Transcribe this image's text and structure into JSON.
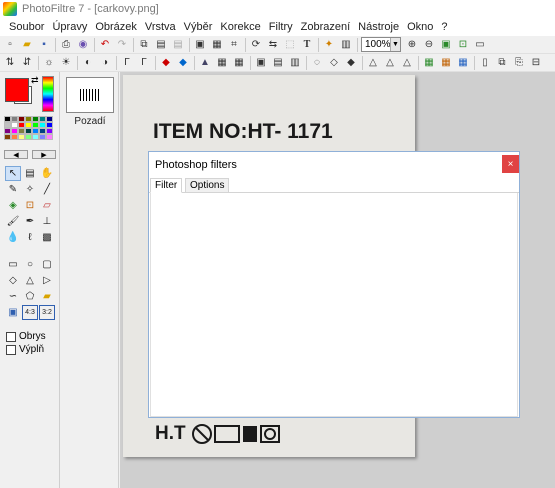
{
  "window": {
    "title": "PhotoFiltre 7 - [carkovy.png]"
  },
  "menu": {
    "items": [
      "Soubor",
      "Úpravy",
      "Obrázek",
      "Vrstva",
      "Výběr",
      "Korekce",
      "Filtry",
      "Zobrazení",
      "Nástroje",
      "Okno",
      "?"
    ]
  },
  "toolbar": {
    "zoom_value": "100%"
  },
  "palette": {
    "foreground_color": "#ff0000",
    "background_color": "#ffffff",
    "swatches": [
      "#000000",
      "#808080",
      "#800000",
      "#808000",
      "#008000",
      "#008080",
      "#000080",
      "#c0c0c0",
      "#ffffff",
      "#ff0000",
      "#ffff00",
      "#00ff00",
      "#00ffff",
      "#0000ff",
      "#800080",
      "#ff00ff",
      "#808040",
      "#004040",
      "#0080ff",
      "#004080",
      "#8000ff",
      "#804000",
      "#ff8040",
      "#ffff80",
      "#80ff80",
      "#80ffff",
      "#8080ff",
      "#ff80ff"
    ]
  },
  "options": {
    "outline_label": "Obrys",
    "fill_label": "Výplň"
  },
  "layers": {
    "items": [
      {
        "label": "Pozadí"
      }
    ]
  },
  "image": {
    "line1": "ITEM NO:HT- 1171",
    "bottom": "H.T"
  },
  "dialog": {
    "title": "Photoshop filters",
    "close_glyph": "×",
    "tabs": [
      {
        "label": "Filter"
      },
      {
        "label": "Options"
      }
    ]
  }
}
